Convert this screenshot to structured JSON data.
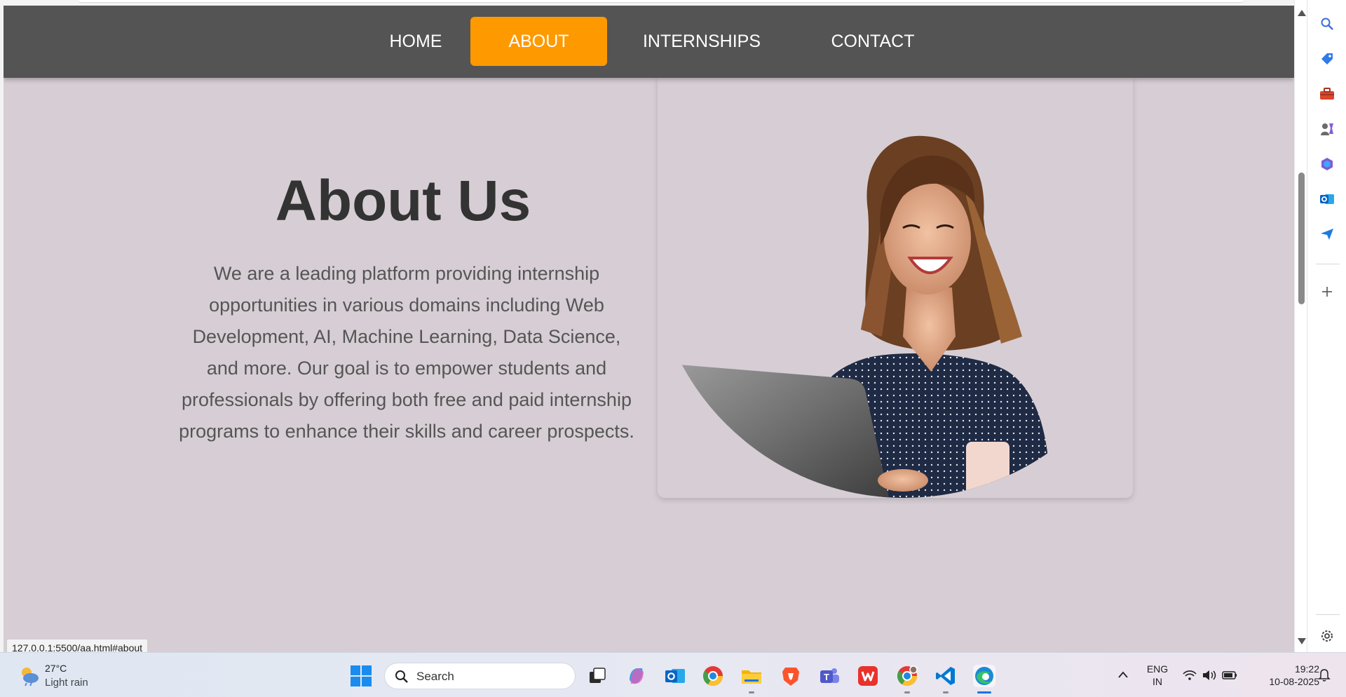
{
  "browser": {
    "status_url": "127.0.0.1:5500/aa.html#about"
  },
  "nav": {
    "items": [
      {
        "label": "HOME",
        "active": false
      },
      {
        "label": "ABOUT",
        "active": true
      },
      {
        "label": "INTERNSHIPS",
        "active": false
      },
      {
        "label": "CONTACT",
        "active": false
      }
    ]
  },
  "about": {
    "title": "About Us",
    "lines": [
      "We are a leading platform providing internship",
      "opportunities in various domains including Web",
      "Development, AI, Machine Learning, Data Science,",
      "and more. Our goal is to empower students and",
      "professionals by offering both free and paid internship",
      "programs to enhance their skills and career prospects."
    ]
  },
  "sidebar": {
    "icons": [
      "search-icon",
      "tag-icon",
      "toolbox-icon",
      "games-icon",
      "copilot-icon",
      "outlook-icon",
      "send-icon",
      "add-icon",
      "settings-icon"
    ]
  },
  "taskbar": {
    "weather_temp": "27°C",
    "weather_desc": "Light rain",
    "search_placeholder": "Search",
    "lang_line1": "ENG",
    "lang_line2": "IN",
    "time": "19:22",
    "date": "10-08-2025"
  },
  "colors": {
    "nav_bg": "#545454",
    "nav_active": "#ff9900",
    "page_bg": "#d6ced4",
    "title": "#333333",
    "body_text": "#555555"
  }
}
